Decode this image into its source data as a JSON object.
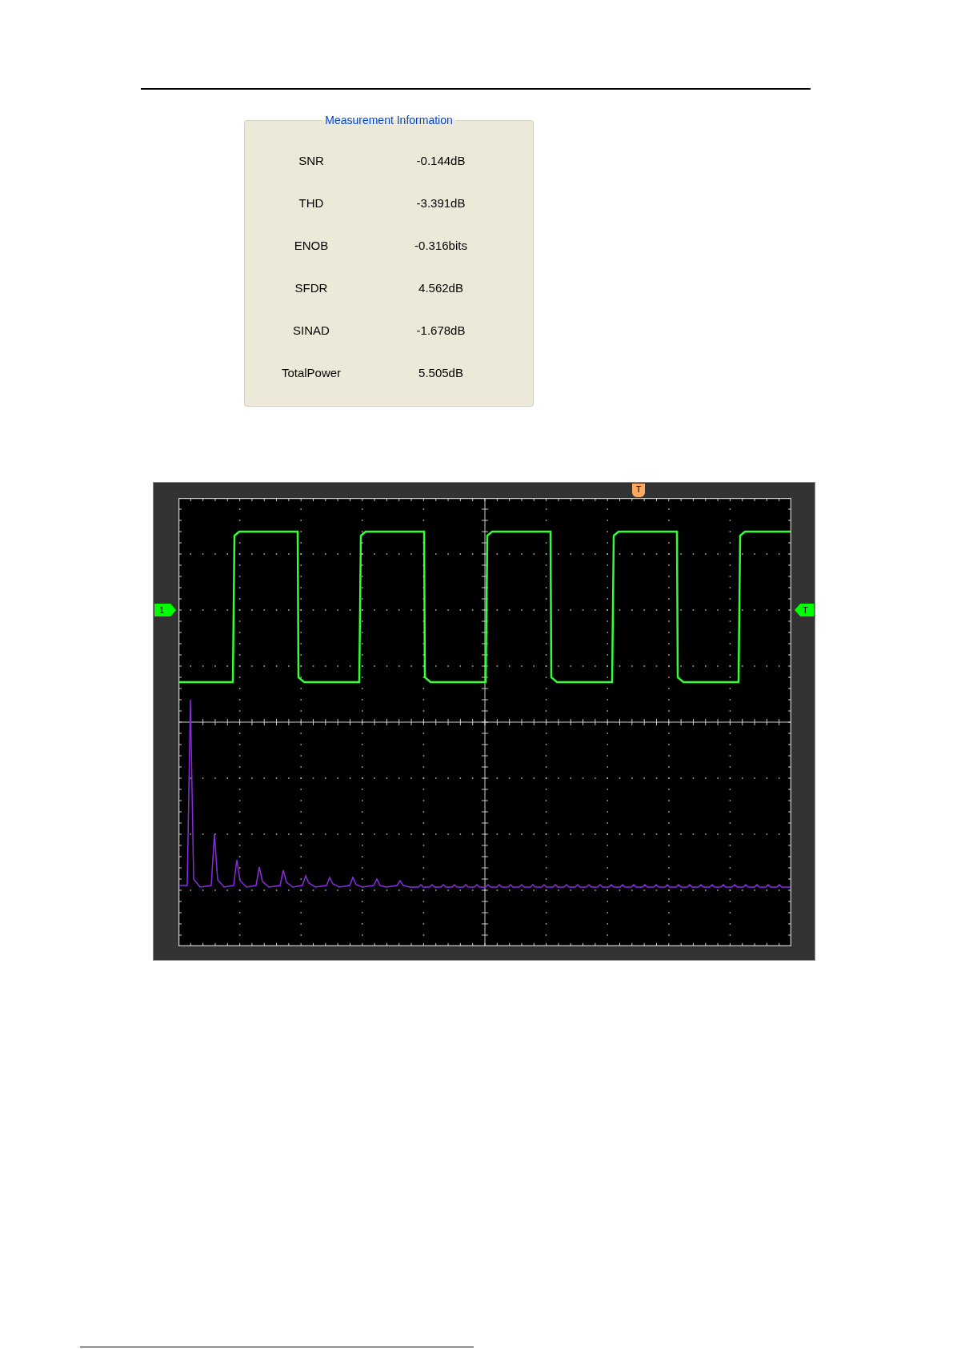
{
  "measurement_panel": {
    "title": "Measurement Information",
    "rows": [
      {
        "label": "SNR",
        "value": "-0.144dB"
      },
      {
        "label": "THD",
        "value": "-3.391dB"
      },
      {
        "label": "ENOB",
        "value": "-0.316bits"
      },
      {
        "label": "SFDR",
        "value": "4.562dB"
      },
      {
        "label": "SINAD",
        "value": "-1.678dB"
      },
      {
        "label": "TotalPower",
        "value": "5.505dB"
      }
    ]
  },
  "oscilloscope": {
    "trigger_position_marker": "T",
    "channel_marker": "1",
    "trigger_level_marker": "T"
  }
}
